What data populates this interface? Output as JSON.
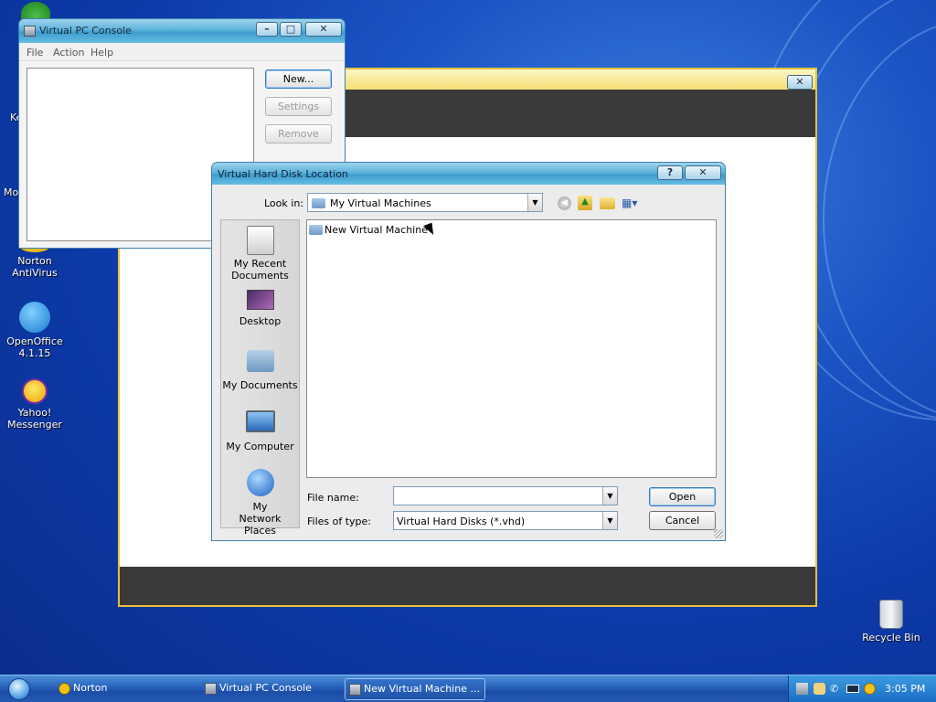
{
  "desktop": {
    "icons": [
      {
        "label": "Norton\nAntiVirus",
        "name": "norton-antivirus"
      },
      {
        "label": "OpenOffice\n4.1.15",
        "name": "openoffice"
      },
      {
        "label": "Yahoo!\nMessenger",
        "name": "yahoo-messenger"
      },
      {
        "label": "Recycle Bin",
        "name": "recycle-bin"
      }
    ],
    "partial_labels": [
      "Ke",
      "Mo"
    ]
  },
  "console": {
    "title": "Virtual PC Console",
    "menu": [
      "File",
      "Action",
      "Help"
    ],
    "buttons": {
      "new": "New...",
      "settings": "Settings",
      "remove": "Remove"
    }
  },
  "dialog": {
    "title": "Virtual Hard Disk Location",
    "help_button": "?",
    "close_button": "✕",
    "look_in_label": "Look in:",
    "look_in_value": "My Virtual Machines",
    "places": [
      {
        "label": "My Recent Documents",
        "name": "recent-documents"
      },
      {
        "label": "Desktop",
        "name": "desktop"
      },
      {
        "label": "My Documents",
        "name": "my-documents"
      },
      {
        "label": "My Computer",
        "name": "my-computer"
      },
      {
        "label": "My Network Places",
        "name": "network-places"
      }
    ],
    "files": [
      "New Virtual Machine"
    ],
    "file_name_label": "File name:",
    "file_name_value": "",
    "files_of_type_label": "Files of type:",
    "files_of_type_value": "Virtual Hard Disks (*.vhd)",
    "open_label": "Open",
    "cancel_label": "Cancel"
  },
  "taskbar": {
    "tasks": [
      {
        "label": "Norton",
        "active": false
      },
      {
        "label": "Virtual PC Console",
        "active": false
      },
      {
        "label": "New Virtual Machine ...",
        "active": true
      }
    ],
    "clock": "3:05 PM"
  },
  "colors": {
    "accent": "#3a79c6",
    "wizard_border": "#e8c23a",
    "titlebar": "#5cb3db"
  }
}
